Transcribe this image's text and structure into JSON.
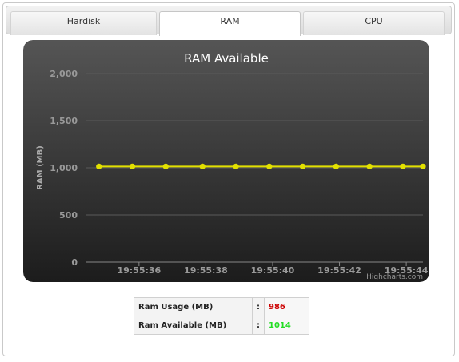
{
  "tabs": [
    {
      "label": "Hardisk",
      "active": false
    },
    {
      "label": "RAM",
      "active": true
    },
    {
      "label": "CPU",
      "active": false
    }
  ],
  "chart_data": {
    "type": "line",
    "title": "RAM Available",
    "ylabel": "RAM (MB)",
    "ylim": [
      0,
      2000
    ],
    "yticks": [
      "0",
      "500",
      "1,000",
      "1,500",
      "2,000"
    ],
    "yticks_values": [
      0,
      500,
      1000,
      1500,
      2000
    ],
    "xticks": [
      "19:55:36",
      "19:55:38",
      "19:55:40",
      "19:55:42",
      "19:55:44"
    ],
    "xlim_seconds": [
      "19:55:34.4",
      "19:55:44.5"
    ],
    "xticks_seconds": [
      "19:55:36",
      "19:55:38",
      "19:55:40",
      "19:55:42",
      "19:55:44"
    ],
    "series": [
      {
        "x": [
          "19:55:34.8",
          "19:55:35.8",
          "19:55:36.8",
          "19:55:37.9",
          "19:55:38.9",
          "19:55:39.9",
          "19:55:40.9",
          "19:55:41.9",
          "19:55:42.9",
          "19:55:43.9",
          "19:55:44.5"
        ],
        "values": [
          1014,
          1014,
          1014,
          1014,
          1014,
          1014,
          1014,
          1014,
          1014,
          1014,
          1014
        ]
      }
    ],
    "credit": "Highcharts.com",
    "grid": true,
    "legend": false,
    "colors": {
      "line": "#e2e000",
      "background_top": "#555555",
      "background_bottom": "#1c1c1c",
      "grid": "#5a5a5a",
      "label": "#999999"
    }
  },
  "stats": {
    "rows": [
      {
        "label": "Ram Usage (MB)",
        "sep": ":",
        "value": "986",
        "color": "#cc0000"
      },
      {
        "label": "Ram Available (MB)",
        "sep": ":",
        "value": "1014",
        "color": "#22dd22"
      }
    ]
  }
}
